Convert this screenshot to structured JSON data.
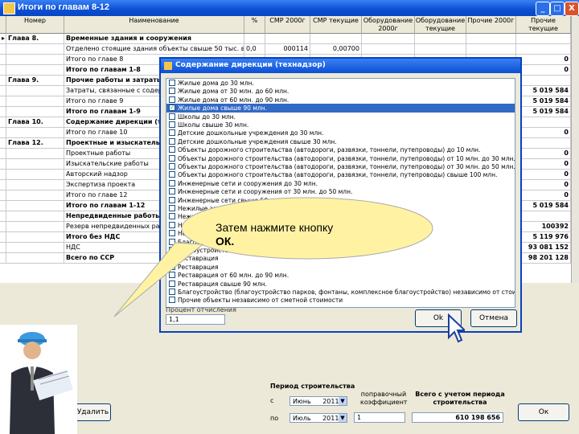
{
  "window": {
    "title": "Итоги по главам 8-12",
    "min": "_",
    "max": "□",
    "close": "X"
  },
  "grid": {
    "headers": [
      "Номер",
      "Наименование",
      "%",
      "СМР 2000г",
      "СМР текущие",
      "Оборудование 2000г",
      "Оборудование текущие",
      "Прочие 2000г",
      "Прочие текущие"
    ],
    "rows": [
      {
        "marker": "▸",
        "num": "Глава 8.",
        "name": "Временные здания и сооружения",
        "bold": true,
        "pct": "",
        "smr2000": "",
        "smrCur": "",
        "total": ""
      },
      {
        "marker": "",
        "num": "",
        "name": "Отделено стоящие здания объекты свыше 50 тыс. в 0",
        "bold": false,
        "pct": "0,0",
        "smr2000": "000114",
        "smrCur": "0,00700",
        "total": ""
      },
      {
        "marker": "",
        "num": "",
        "name": "Итого по главе 8",
        "bold": false,
        "pct": "",
        "smr2000": "",
        "smrCur": "",
        "total": "0"
      },
      {
        "marker": "",
        "num": "",
        "name": "Итого по главам 1-8",
        "bold": true,
        "pct": "",
        "smr2000": "",
        "smrCur": "",
        "total": "0"
      },
      {
        "marker": "",
        "num": "Глава 9.",
        "name": "Прочие работы и затраты",
        "bold": true,
        "pct": "",
        "smr2000": "",
        "smrCur": "",
        "total": ""
      },
      {
        "marker": "",
        "num": "",
        "name": "Затраты, связанные с содержанием",
        "bold": false,
        "pct": "",
        "smr2000": "",
        "smrCur": "",
        "total": "5 019 584"
      },
      {
        "marker": "",
        "num": "",
        "name": "Итого по главе 9",
        "bold": false,
        "pct": "",
        "smr2000": "",
        "smrCur": "",
        "total": "5 019 584"
      },
      {
        "marker": "",
        "num": "",
        "name": "Итого по главам 1-9",
        "bold": true,
        "pct": "",
        "smr2000": "",
        "smrCur": "",
        "total": "5 019 584"
      },
      {
        "marker": "",
        "num": "Глава 10.",
        "name": "Содержание дирекции (технадзор)",
        "bold": true,
        "pct": "",
        "smr2000": "",
        "smrCur": "",
        "total": ""
      },
      {
        "marker": "",
        "num": "",
        "name": "Итого по главе 10",
        "bold": false,
        "pct": "",
        "smr2000": "",
        "smrCur": "",
        "total": "0"
      },
      {
        "marker": "",
        "num": "Глава 12.",
        "name": "Проектные и изыскательские работы",
        "bold": true,
        "pct": "",
        "smr2000": "",
        "smrCur": "",
        "total": ""
      },
      {
        "marker": "",
        "num": "",
        "name": "Проектные работы",
        "bold": false,
        "pct": "",
        "smr2000": "",
        "smrCur": "",
        "total": "0"
      },
      {
        "marker": "",
        "num": "",
        "name": "Изыскательские работы",
        "bold": false,
        "pct": "",
        "smr2000": "",
        "smrCur": "",
        "total": "0"
      },
      {
        "marker": "",
        "num": "",
        "name": "Авторский надзор",
        "bold": false,
        "pct": "",
        "smr2000": "",
        "smrCur": "",
        "total": "0"
      },
      {
        "marker": "",
        "num": "",
        "name": "Экспертиза проекта",
        "bold": false,
        "pct": "",
        "smr2000": "",
        "smrCur": "",
        "total": "0"
      },
      {
        "marker": "",
        "num": "",
        "name": "Итого по главе 12",
        "bold": false,
        "pct": "",
        "smr2000": "",
        "smrCur": "",
        "total": "0"
      },
      {
        "marker": "",
        "num": "",
        "name": "Итого по главам 1-12",
        "bold": true,
        "pct": "",
        "smr2000": "",
        "smrCur": "",
        "total": "5 019 584"
      },
      {
        "marker": "",
        "num": "",
        "name": "Непредвиденные работы и затраты",
        "bold": true,
        "pct": "",
        "smr2000": "",
        "smrCur": "",
        "total": ""
      },
      {
        "marker": "",
        "num": "",
        "name": "Резерв непредвиденных работ и затрат",
        "bold": false,
        "pct": "",
        "smr2000": "",
        "smrCur": "",
        "total": "100392"
      },
      {
        "marker": "",
        "num": "",
        "name": "Итого без НДС",
        "bold": true,
        "pct": "",
        "smr2000": "",
        "smrCur": "",
        "total": "5 119 976"
      },
      {
        "marker": "",
        "num": "",
        "name": "НДС",
        "bold": false,
        "pct": "",
        "smr2000": "",
        "smrCur": "",
        "total": "93 081 152"
      },
      {
        "marker": "",
        "num": "",
        "name": "Всего по ССР",
        "bold": true,
        "pct": "",
        "smr2000": "",
        "smrCur": "",
        "total": "98 201 128"
      }
    ]
  },
  "dialog": {
    "title": "Содержание дирекции (технадзор)",
    "items": [
      {
        "label": "Жилые дома до 30 млн.",
        "checked": false
      },
      {
        "label": "Жилые дома от 30 млн. до 60 млн.",
        "checked": false
      },
      {
        "label": "Жилые дома от 60 млн. до 90 млн.",
        "checked": false
      },
      {
        "label": "Жилые дома свыше 90 млн.",
        "checked": true
      },
      {
        "label": "Школы до 30 млн.",
        "checked": false
      },
      {
        "label": "Школы свыше 30 млн.",
        "checked": false
      },
      {
        "label": "Детские дошкольные учреждения до 30 млн.",
        "checked": false
      },
      {
        "label": "Детские дошкольные учреждения свыше 30 млн.",
        "checked": false
      },
      {
        "label": "Объекты дорожного строительства (автодороги, развязки, тоннели, путепроводы) до 10 млн.",
        "checked": false
      },
      {
        "label": "Объекты дорожного строительства (автодороги, развязки, тоннели, путепроводы) от 10 млн. до 30 млн.",
        "checked": false
      },
      {
        "label": "Объекты дорожного строительства (автодороги, развязки, тоннели, путепроводы) от 30 млн. до 50 млн.",
        "checked": false
      },
      {
        "label": "Объекты дорожного строительства (автодороги, развязки, тоннели, путепроводы) свыше 100 млн.",
        "checked": false
      },
      {
        "label": "Инженерные сети и сооружения до 30 млн.",
        "checked": false
      },
      {
        "label": "Инженерные сети и сооружения от 30 млн. до 50 млн.",
        "checked": false
      },
      {
        "label": "Инженерные сети свыше 50 млн.",
        "checked": false
      },
      {
        "label": "Нежилые здания до 30 млн.",
        "checked": false
      },
      {
        "label": "Нежилые",
        "checked": false
      },
      {
        "label": "Нежилые",
        "checked": false
      },
      {
        "label": "Нежилые",
        "checked": false
      },
      {
        "label": "Благоустройство",
        "checked": false
      },
      {
        "label": "Благоустройство",
        "checked": false
      },
      {
        "label": "Реставрация",
        "checked": false
      },
      {
        "label": "Реставрация",
        "checked": false
      },
      {
        "label": "Реставрация от 60 млн. до 90 млн.",
        "checked": false
      },
      {
        "label": "Реставрация свыше 90 млн.",
        "checked": false
      },
      {
        "label": "Благоустройство (благоустройство парков, фонтаны, комплексное благоустройство) независимо от стоимости",
        "checked": false
      },
      {
        "label": "Прочие объекты независимо от сметной стоимости",
        "checked": false
      }
    ],
    "pct_label": "Процент отчисления",
    "pct_value": "1,1",
    "ok": "Ok",
    "cancel": "Отмена"
  },
  "callout": {
    "text1": "Затем   нажмите   кнопку",
    "text2": "ОК."
  },
  "bottom": {
    "period_title": "Период строительства",
    "from_label": "с",
    "to_label": "по",
    "from_month": "Июнь",
    "from_year": "2011",
    "to_month": "Июль",
    "to_year": "2011",
    "coef_label": "поправочный коэффициент",
    "coef_value": "1",
    "total_label": "Всего с учетом периода строительства",
    "total_value": "610 198 656",
    "delete_label": "Удалить",
    "ok_label": "Ок"
  },
  "colors": {
    "titlebar": "#0a4fd4",
    "selection": "#316ac5",
    "callout": "#fff3a3"
  }
}
